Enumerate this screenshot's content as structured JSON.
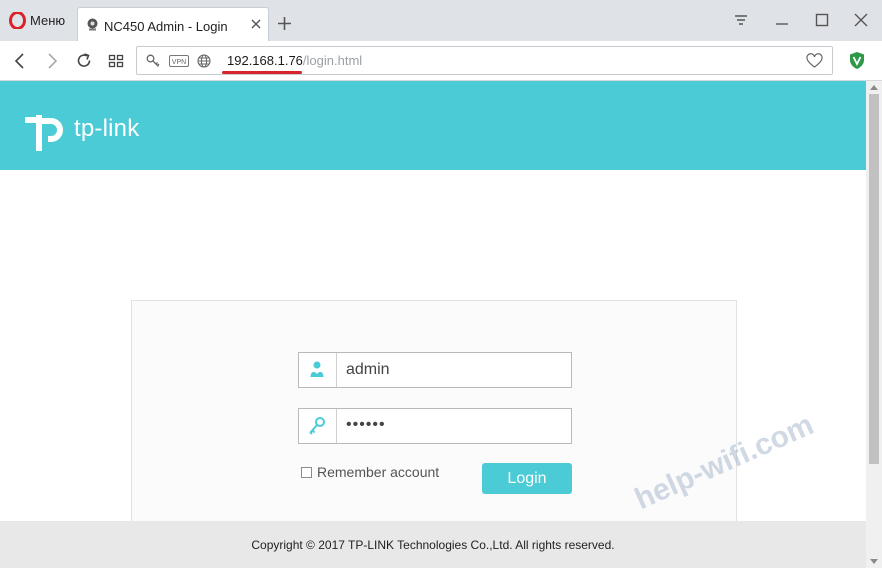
{
  "browser": {
    "menu_label": "Меню",
    "tab_title": "NC450 Admin - Login",
    "url_host": "192.168.1.76",
    "url_path": "/login.html",
    "vpn_label": "VPN"
  },
  "page": {
    "brand": "tp-link",
    "username_value": "admin",
    "password_value": "••••••",
    "remember_label": "Remember account",
    "login_label": "Login",
    "copyright": "Copyright © 2017 TP-LINK Technologies Co.,Ltd. All rights reserved.",
    "watermark": "help-wifi.com"
  },
  "colors": {
    "accent": "#4acbd6",
    "opera_red": "#d9232b"
  }
}
